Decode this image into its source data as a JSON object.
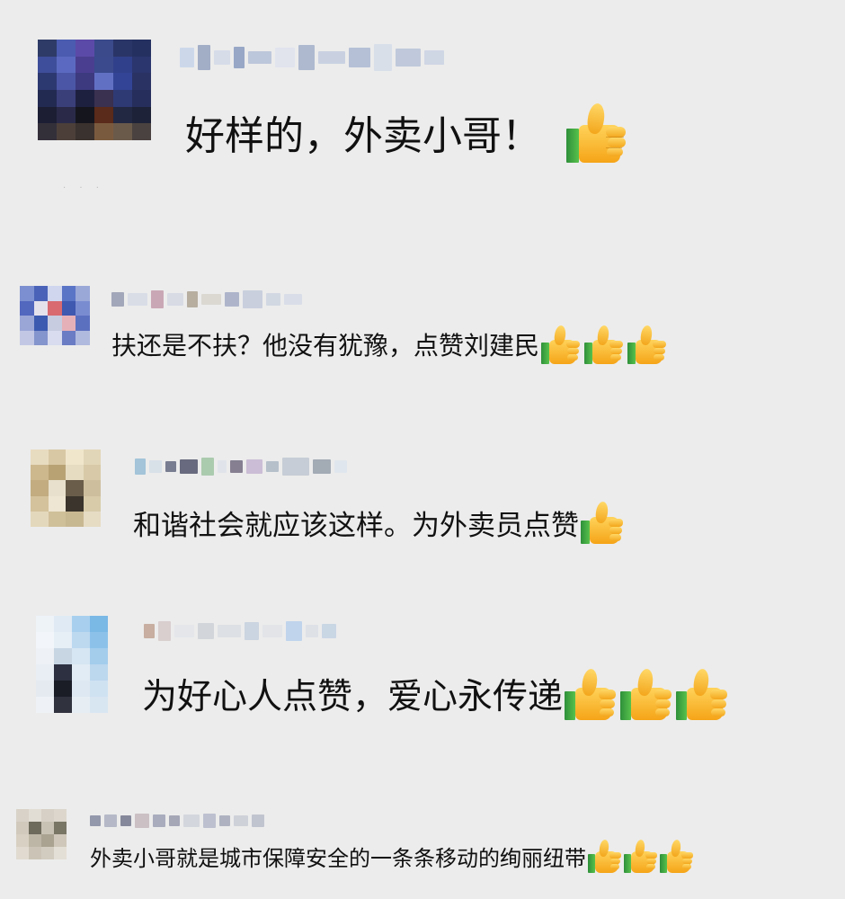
{
  "comments": [
    {
      "text": "好样的，外卖小哥！",
      "thumbs": [
        "thumbs-up-icon"
      ]
    },
    {
      "text": "扶还是不扶？他没有犹豫，点赞刘建民",
      "thumbs": [
        "thumbs-up-icon",
        "thumbs-up-icon",
        "thumbs-up-icon"
      ]
    },
    {
      "text": "和谐社会就应该这样。为外卖员点赞",
      "thumbs": [
        "thumbs-up-icon"
      ]
    },
    {
      "text": "为好心人点赞，爱心永传递",
      "thumbs": [
        "thumbs-up-icon",
        "thumbs-up-icon",
        "thumbs-up-icon"
      ]
    },
    {
      "text": "外卖小哥就是城市保障安全的一条条移动的绚丽纽带",
      "thumbs": [
        "thumbs-up-icon",
        "thumbs-up-icon",
        "thumbs-up-icon"
      ]
    }
  ],
  "colors": {
    "background": "#ececec",
    "text": "#111111",
    "thumb_yellow": "#f5b52a",
    "thumb_cuff": "#3aa640"
  }
}
